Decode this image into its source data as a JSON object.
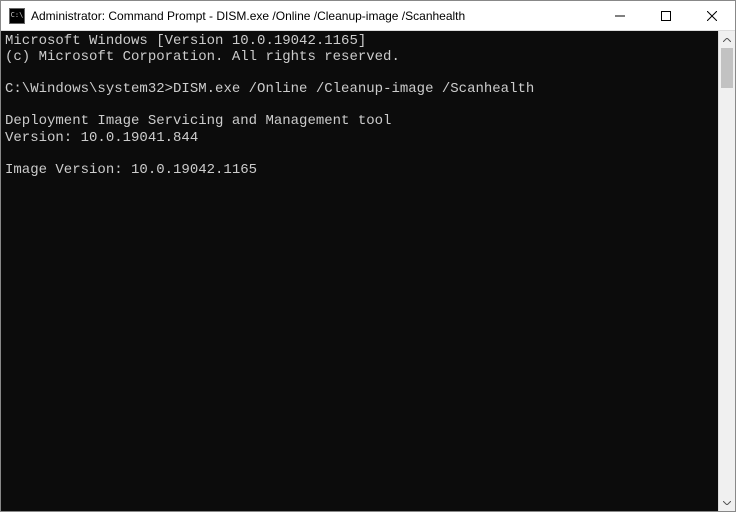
{
  "titlebar": {
    "icon_label": "C:\\",
    "title": "Administrator: Command Prompt - DISM.exe  /Online /Cleanup-image /Scanhealth"
  },
  "terminal": {
    "line1": "Microsoft Windows [Version 10.0.19042.1165]",
    "line2": "(c) Microsoft Corporation. All rights reserved.",
    "blank1": "",
    "prompt_path": "C:\\Windows\\system32>",
    "prompt_cmd": "DISM.exe /Online /Cleanup-image /Scanhealth",
    "blank2": "",
    "line3": "Deployment Image Servicing and Management tool",
    "line4": "Version: 10.0.19041.844",
    "blank3": "",
    "line5": "Image Version: 10.0.19042.1165"
  }
}
